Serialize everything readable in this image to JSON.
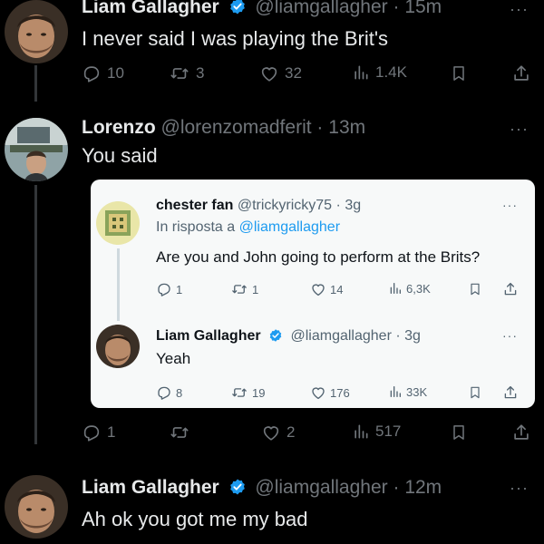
{
  "tweets": [
    {
      "name": "Liam Gallagher",
      "handle": "@liamgallagher",
      "sep": "·",
      "time": "15m",
      "verified": true,
      "text": "I never said I was playing the Brit's",
      "stats": {
        "replies": "10",
        "retweets": "3",
        "likes": "32",
        "views": "1.4K"
      }
    },
    {
      "name": "Lorenzo",
      "handle": "@lorenzomadferit",
      "sep": "·",
      "time": "13m",
      "verified": false,
      "text": "You said",
      "stats": {
        "replies": "1",
        "retweets": "",
        "likes": "2",
        "views": "517"
      }
    },
    {
      "name": "Liam Gallagher",
      "handle": "@liamgallagher",
      "sep": "·",
      "time": "12m",
      "verified": true,
      "text": "Ah ok you got me my bad"
    }
  ],
  "embed": {
    "first": {
      "name": "chester fan",
      "handle": "@trickyricky75",
      "sep": "·",
      "time": "3g",
      "reply_prefix": "In risposta a",
      "reply_mention": "@liamgallagher",
      "text": "Are you and John going to perform at the Brits?",
      "stats": {
        "replies": "1",
        "retweets": "1",
        "likes": "14",
        "views": "6,3K"
      }
    },
    "second": {
      "name": "Liam Gallagher",
      "handle": "@liamgallagher",
      "sep": "·",
      "time": "3g",
      "text": "Yeah",
      "stats": {
        "replies": "8",
        "retweets": "19",
        "likes": "176",
        "views": "33K"
      }
    }
  },
  "more_label": "···",
  "colors": {
    "background": "#000000",
    "accent": "#1d9bf0",
    "muted": "#71767b"
  }
}
